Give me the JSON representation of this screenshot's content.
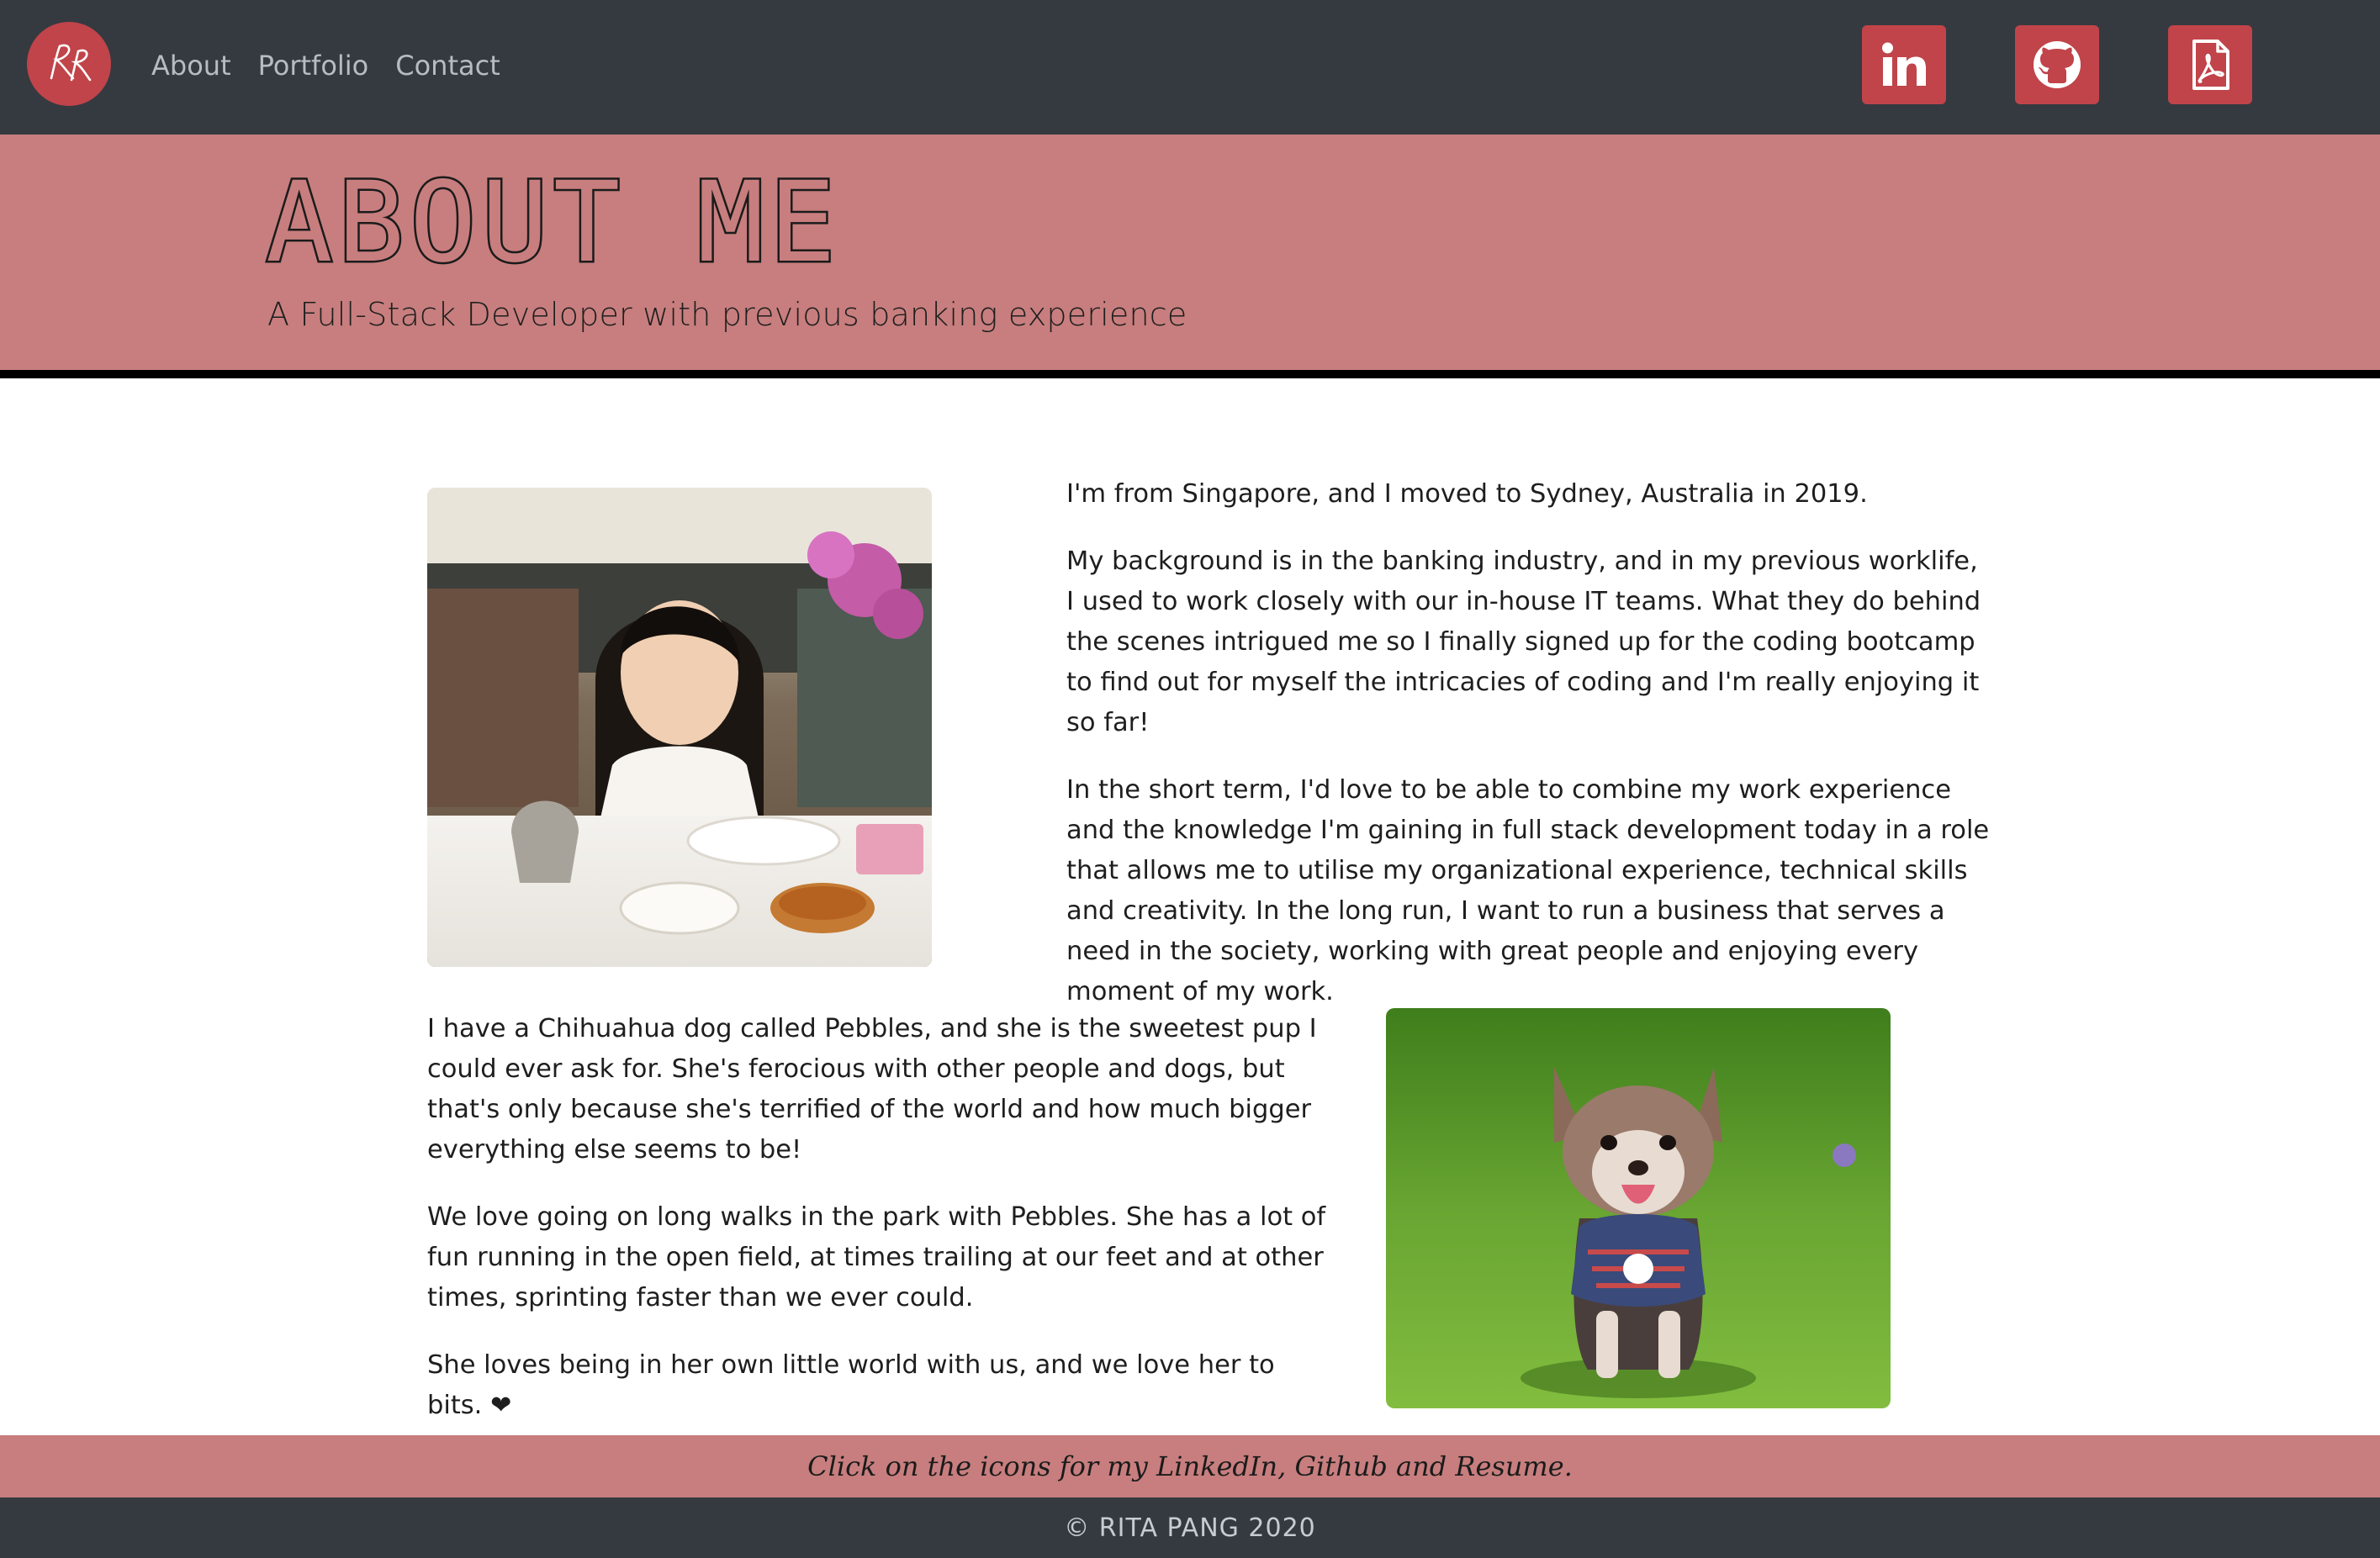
{
  "colors": {
    "navbar": "#343a40",
    "accent": "#c0444a",
    "hero": "#c87e7e",
    "nav_link": "#b8bcc0"
  },
  "nav": {
    "logo_icon": "rp-monogram-logo",
    "links": [
      "About",
      "Portfolio",
      "Contact"
    ],
    "social_icons": [
      "linkedin-icon",
      "github-icon",
      "pdf-resume-icon"
    ]
  },
  "hero": {
    "title": "ABOUT ME",
    "subtitle": "A Full-Stack Developer with previous banking experience"
  },
  "about": {
    "paragraphs": [
      "I'm from Singapore, and I moved to Sydney, Australia in 2019.",
      "My background is in the banking industry, and in my previous worklife, I used to work closely with our in-house IT teams. What they do behind the scenes intrigued me so I finally signed up for the coding bootcamp to find out for myself the intricacies of coding and I'm really enjoying it so far!",
      "In the short term, I'd love to be able to combine my work experience and the knowledge I'm gaining in full stack development today in a role that allows me to utilise my organizational experience, technical skills and creativity. In the long run, I want to run a business that serves a need in the society, working with great people and enjoying every moment of my work."
    ]
  },
  "pet": {
    "paragraphs": [
      "I have a Chihuahua dog called Pebbles, and she is the sweetest pup I could ever ask for. She's ferocious with other people and dogs, but that's only because she's terrified of the world and how much bigger everything else seems to be!",
      "We love going on long walks in the park with Pebbles. She has a lot of fun running in the open field, at times trailing at our feet and at other times, sprinting faster than we ever could.",
      "She loves being in her own little world with us, and we love her to bits."
    ],
    "heart": "❤"
  },
  "footer": {
    "note": "Click on the icons for my LinkedIn, Github and Resume.",
    "copyright": "© RITA PANG 2020"
  }
}
